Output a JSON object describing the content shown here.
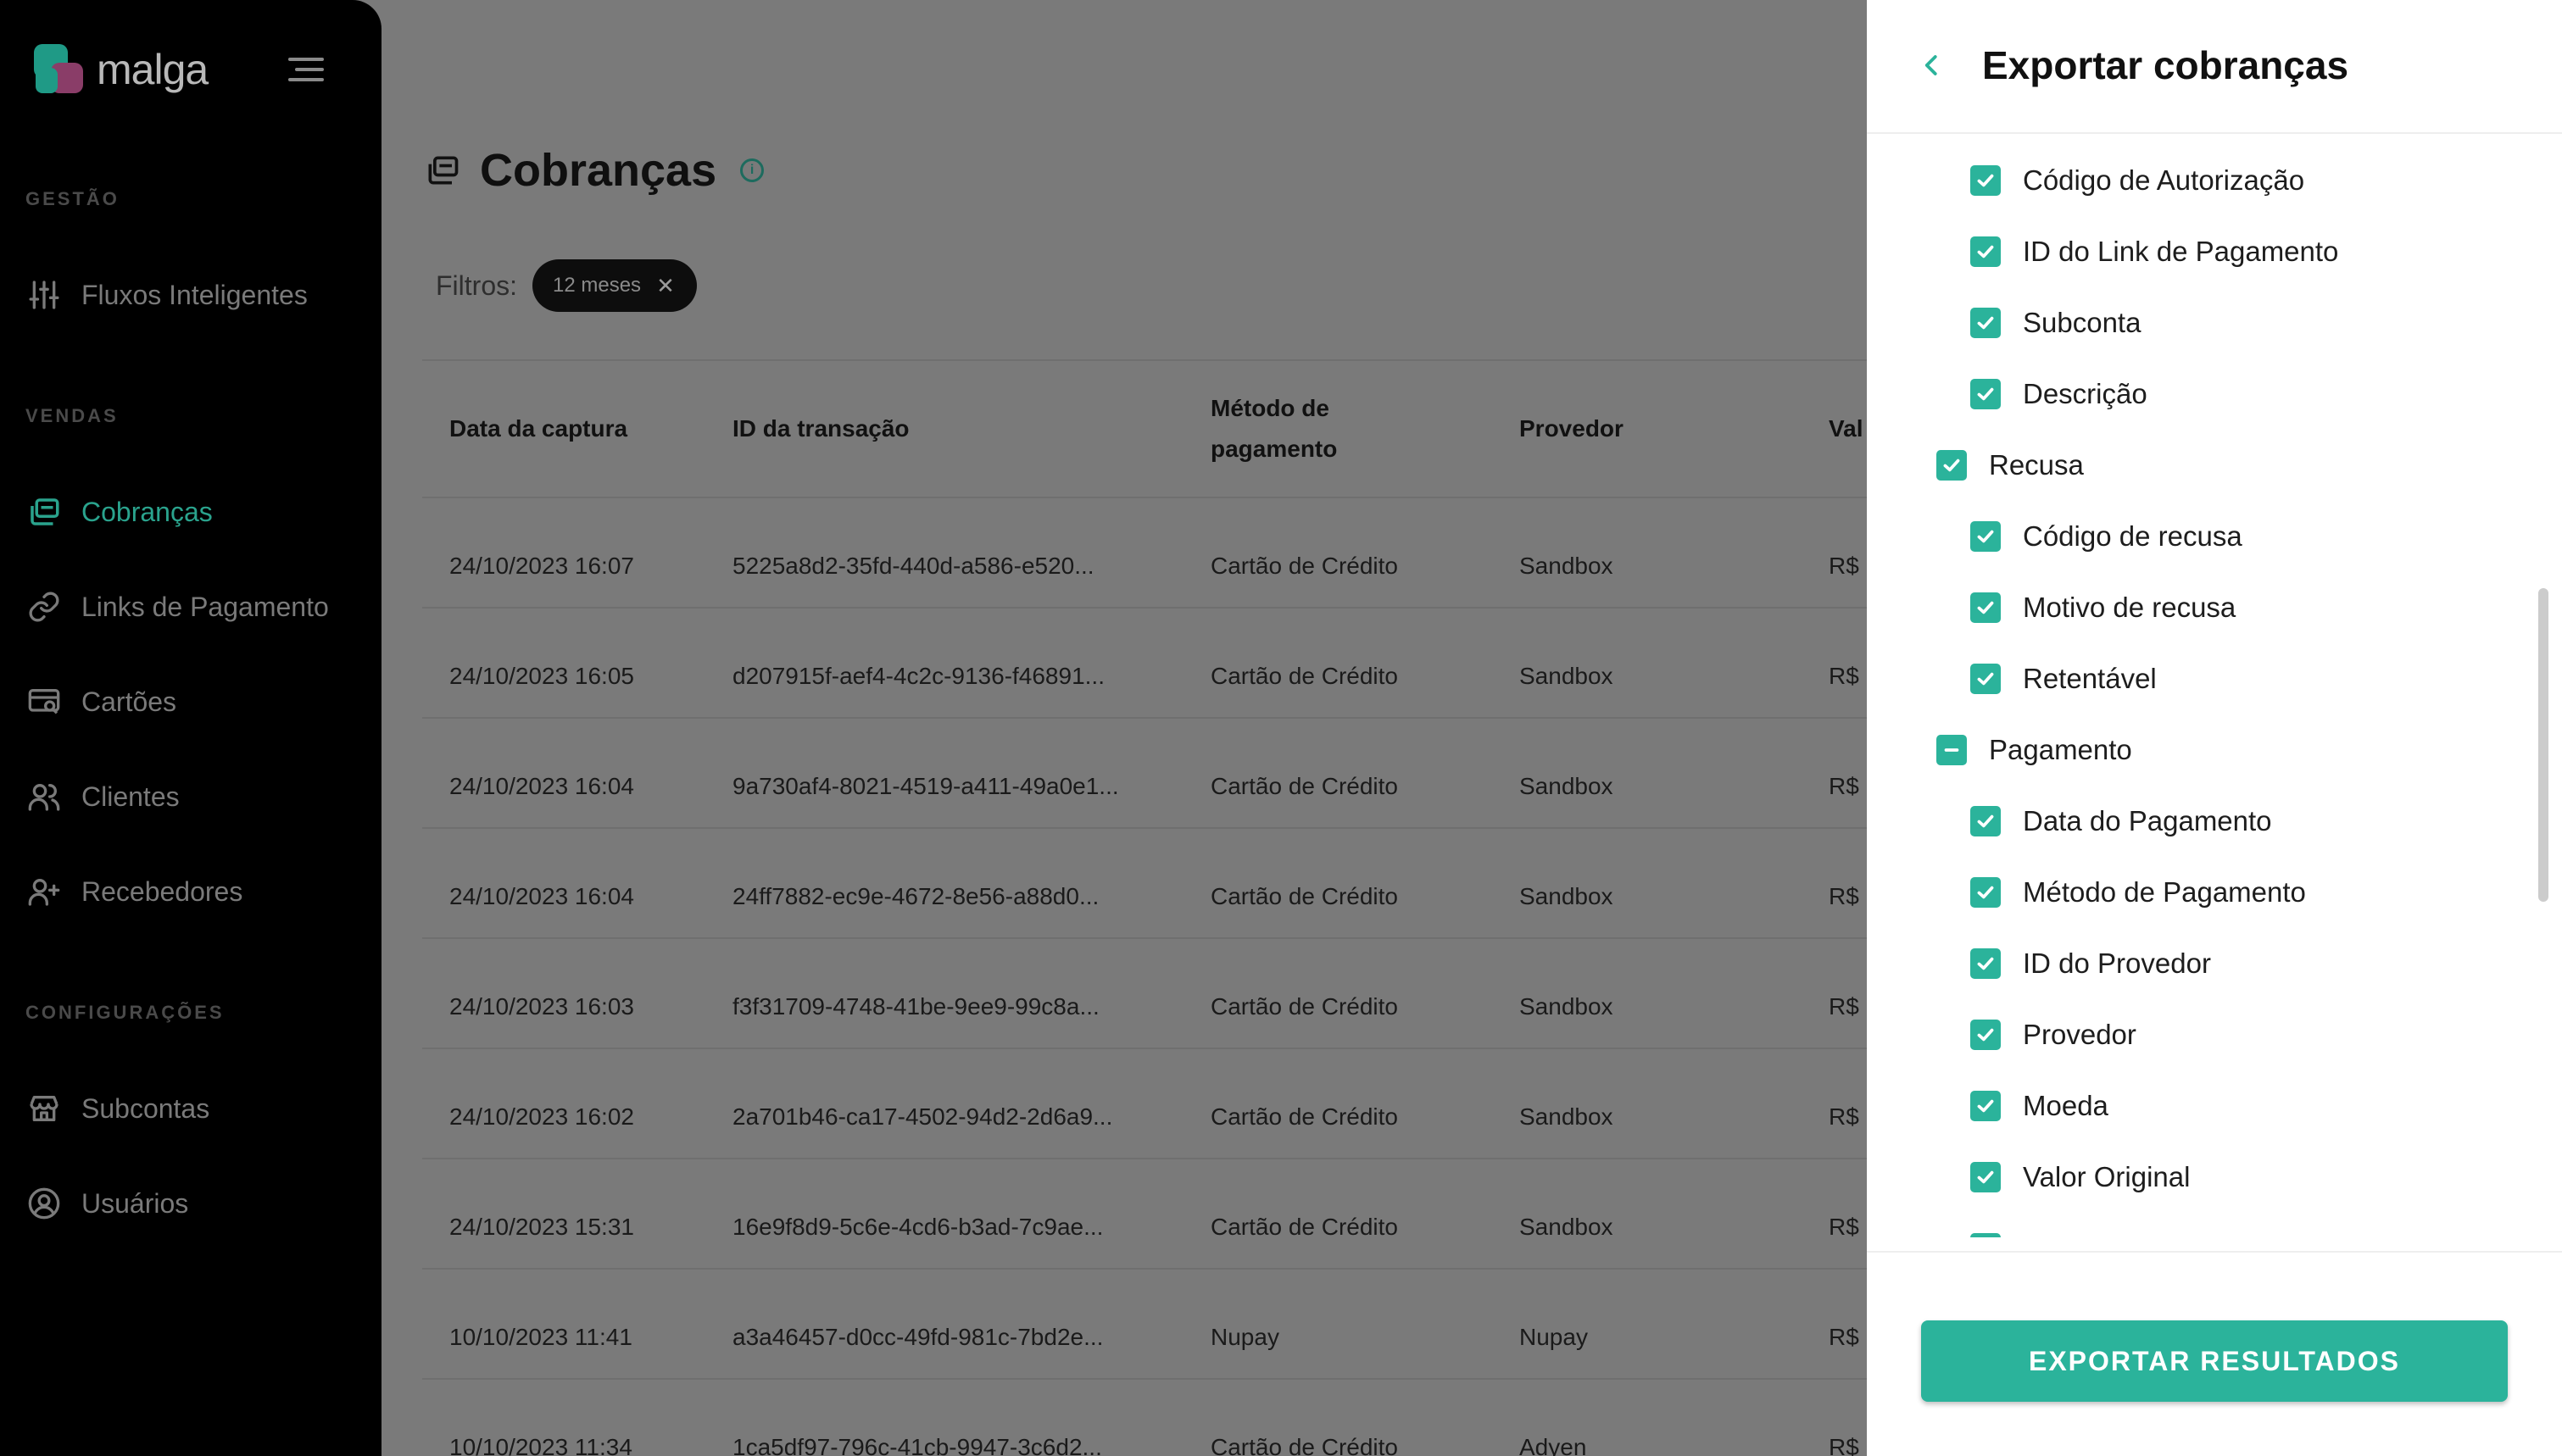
{
  "brand": {
    "name": "malga"
  },
  "sidebar": {
    "sections": [
      {
        "label": "GESTÃO"
      },
      {
        "label": "VENDAS"
      },
      {
        "label": "CONFIGURAÇÕES"
      }
    ],
    "items": [
      {
        "label": "Fluxos Inteligentes",
        "icon": "sliders-icon"
      },
      {
        "label": "Cobranças",
        "icon": "charges-icon",
        "active": true
      },
      {
        "label": "Links de Pagamento",
        "icon": "link-icon"
      },
      {
        "label": "Cartões",
        "icon": "card-search-icon"
      },
      {
        "label": "Clientes",
        "icon": "users-icon"
      },
      {
        "label": "Recebedores",
        "icon": "user-plus-icon"
      },
      {
        "label": "Subcontas",
        "icon": "store-icon"
      },
      {
        "label": "Usuários",
        "icon": "user-circle-icon"
      }
    ]
  },
  "main": {
    "title": "Cobranças",
    "filters_label": "Filtros:",
    "filter_chip": "12 meses",
    "columns": [
      "Data da captura",
      "ID da transação",
      "Método de pagamento",
      "Provedor",
      "Val"
    ],
    "rows": [
      {
        "date": "24/10/2023 16:07",
        "id": "5225a8d2-35fd-440d-a586-e520...",
        "method": "Cartão de Crédito",
        "provider": "Sandbox",
        "value": "R$"
      },
      {
        "date": "24/10/2023 16:05",
        "id": "d207915f-aef4-4c2c-9136-f46891...",
        "method": "Cartão de Crédito",
        "provider": "Sandbox",
        "value": "R$"
      },
      {
        "date": "24/10/2023 16:04",
        "id": "9a730af4-8021-4519-a411-49a0e1...",
        "method": "Cartão de Crédito",
        "provider": "Sandbox",
        "value": "R$"
      },
      {
        "date": "24/10/2023 16:04",
        "id": "24ff7882-ec9e-4672-8e56-a88d0...",
        "method": "Cartão de Crédito",
        "provider": "Sandbox",
        "value": "R$"
      },
      {
        "date": "24/10/2023 16:03",
        "id": "f3f31709-4748-41be-9ee9-99c8a...",
        "method": "Cartão de Crédito",
        "provider": "Sandbox",
        "value": "R$"
      },
      {
        "date": "24/10/2023 16:02",
        "id": "2a701b46-ca17-4502-94d2-2d6a9...",
        "method": "Cartão de Crédito",
        "provider": "Sandbox",
        "value": "R$"
      },
      {
        "date": "24/10/2023 15:31",
        "id": "16e9f8d9-5c6e-4cd6-b3ad-7c9ae...",
        "method": "Cartão de Crédito",
        "provider": "Sandbox",
        "value": "R$"
      },
      {
        "date": "10/10/2023 11:41",
        "id": "a3a46457-d0cc-49fd-981c-7bd2e...",
        "method": "Nupay",
        "provider": "Nupay",
        "value": "R$"
      },
      {
        "date": "10/10/2023 11:34",
        "id": "1ca5df97-796c-41cb-9947-3c6d2...",
        "method": "Cartão de Crédito",
        "provider": "Adyen",
        "value": "R$"
      }
    ]
  },
  "drawer": {
    "title": "Exportar cobranças",
    "items": [
      {
        "label": "Código de Autorização",
        "level": 2,
        "state": "checked"
      },
      {
        "label": "ID do Link de Pagamento",
        "level": 2,
        "state": "checked"
      },
      {
        "label": "Subconta",
        "level": 2,
        "state": "checked"
      },
      {
        "label": "Descrição",
        "level": 2,
        "state": "checked"
      },
      {
        "label": "Recusa",
        "level": 1,
        "state": "checked"
      },
      {
        "label": "Código de recusa",
        "level": 2,
        "state": "checked"
      },
      {
        "label": "Motivo de recusa",
        "level": 2,
        "state": "checked"
      },
      {
        "label": "Retentável",
        "level": 2,
        "state": "checked"
      },
      {
        "label": "Pagamento",
        "level": 1,
        "state": "indeterminate"
      },
      {
        "label": "Data do Pagamento",
        "level": 2,
        "state": "checked"
      },
      {
        "label": "Método de Pagamento",
        "level": 2,
        "state": "checked"
      },
      {
        "label": "ID do Provedor",
        "level": 2,
        "state": "checked"
      },
      {
        "label": "Provedor",
        "level": 2,
        "state": "checked"
      },
      {
        "label": "Moeda",
        "level": 2,
        "state": "checked"
      },
      {
        "label": "Valor Original",
        "level": 2,
        "state": "checked"
      }
    ],
    "export_button": "EXPORTAR RESULTADOS"
  },
  "colors": {
    "accent": "#2bb39b",
    "sidebar_bg": "#000000",
    "overlay_bg": "#7a7a7a"
  }
}
